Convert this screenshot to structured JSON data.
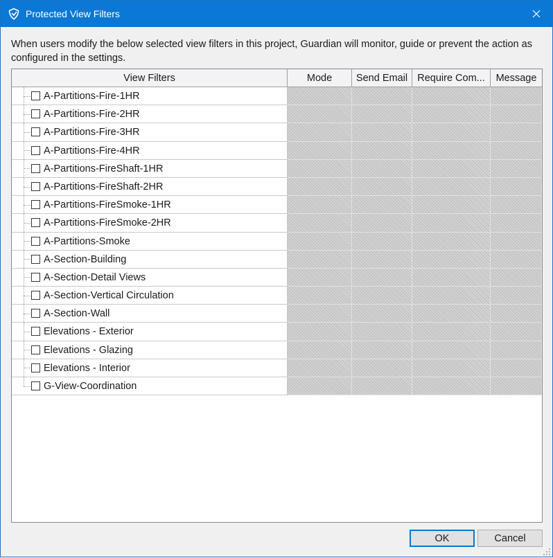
{
  "window": {
    "title": "Protected View Filters",
    "icon": "guardian-shield-icon",
    "close_glyph": "✕"
  },
  "description": "When users modify the below selected view filters in this project, Guardian will monitor, guide or prevent the action as configured in the settings.",
  "grid": {
    "columns": [
      "View Filters",
      "Mode",
      "Send Email",
      "Require Com...",
      "Message"
    ],
    "rows": [
      {
        "name": "A-Partitions-Fire-1HR",
        "checked": false
      },
      {
        "name": "A-Partitions-Fire-2HR",
        "checked": false
      },
      {
        "name": "A-Partitions-Fire-3HR",
        "checked": false
      },
      {
        "name": "A-Partitions-Fire-4HR",
        "checked": false
      },
      {
        "name": "A-Partitions-FireShaft-1HR",
        "checked": false
      },
      {
        "name": "A-Partitions-FireShaft-2HR",
        "checked": false
      },
      {
        "name": "A-Partitions-FireSmoke-1HR",
        "checked": false
      },
      {
        "name": "A-Partitions-FireSmoke-2HR",
        "checked": false
      },
      {
        "name": "A-Partitions-Smoke",
        "checked": false
      },
      {
        "name": "A-Section-Building",
        "checked": false
      },
      {
        "name": "A-Section-Detail Views",
        "checked": false
      },
      {
        "name": "A-Section-Vertical Circulation",
        "checked": false
      },
      {
        "name": "A-Section-Wall",
        "checked": false
      },
      {
        "name": "Elevations - Exterior",
        "checked": false
      },
      {
        "name": "Elevations - Glazing",
        "checked": false
      },
      {
        "name": "Elevations - Interior",
        "checked": false
      },
      {
        "name": "G-View-Coordination",
        "checked": false
      }
    ]
  },
  "buttons": {
    "ok": "OK",
    "cancel": "Cancel"
  },
  "colors": {
    "titlebar": "#0a78d4",
    "accent": "#0078d7"
  }
}
